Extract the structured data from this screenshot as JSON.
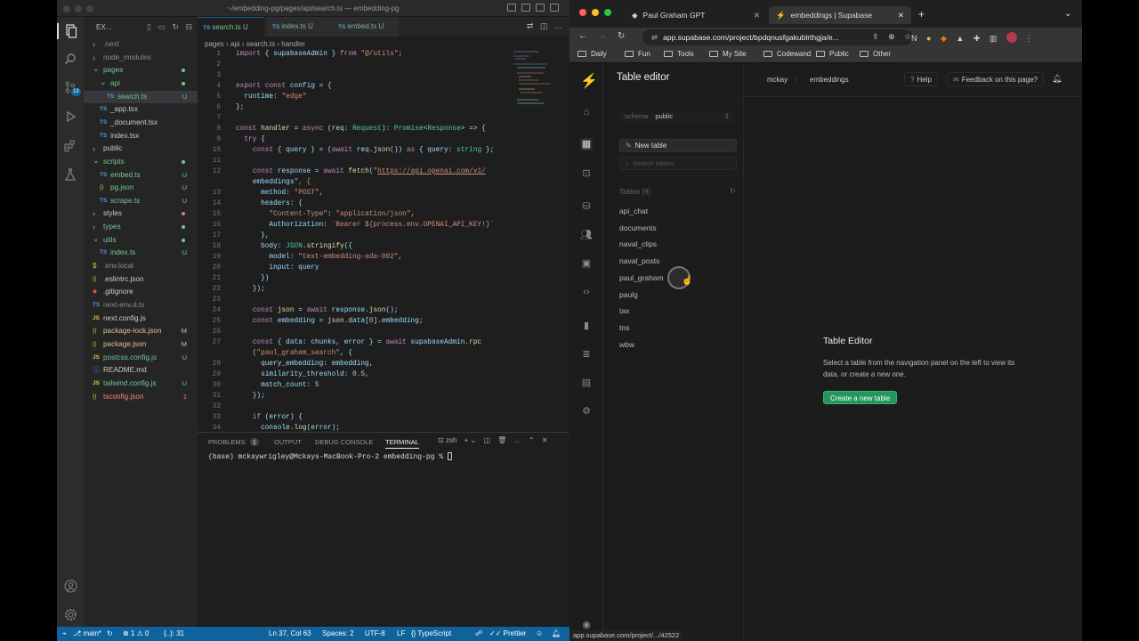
{
  "vscode": {
    "title": "~/embedding-pg/pages/api/search.ts — embedding-pg",
    "explorer_label": "EX...",
    "tree": [
      {
        "name": ".next",
        "depth": 0,
        "type": "folder",
        "color": "#8c8c8c"
      },
      {
        "name": "node_modules",
        "depth": 0,
        "type": "folder",
        "color": "#8c8c8c"
      },
      {
        "name": "pages",
        "depth": 0,
        "type": "folder-open",
        "color": "#73c991",
        "dot": "#73c991"
      },
      {
        "name": "api",
        "depth": 1,
        "type": "folder-open",
        "color": "#73c991",
        "dot": "#73c991"
      },
      {
        "name": "search.ts",
        "depth": 2,
        "type": "ts",
        "color": "#73c991",
        "status": "U",
        "selected": true
      },
      {
        "name": "_app.tsx",
        "depth": 1,
        "type": "ts",
        "color": "#cccccc"
      },
      {
        "name": "_document.tsx",
        "depth": 1,
        "type": "ts",
        "color": "#cccccc"
      },
      {
        "name": "index.tsx",
        "depth": 1,
        "type": "ts",
        "color": "#cccccc"
      },
      {
        "name": "public",
        "depth": 0,
        "type": "folder",
        "color": "#cccccc"
      },
      {
        "name": "scripts",
        "depth": 0,
        "type": "folder-open",
        "color": "#73c991",
        "dot": "#73c991"
      },
      {
        "name": "embed.ts",
        "depth": 1,
        "type": "ts",
        "color": "#73c991",
        "status": "U"
      },
      {
        "name": "pg.json",
        "depth": 1,
        "type": "json",
        "color": "#73c991",
        "status": "U"
      },
      {
        "name": "scrape.ts",
        "depth": 1,
        "type": "ts",
        "color": "#73c991",
        "status": "U"
      },
      {
        "name": "styles",
        "depth": 0,
        "type": "folder",
        "color": "#cccccc",
        "dot": "#e2766b"
      },
      {
        "name": "types",
        "depth": 0,
        "type": "folder",
        "color": "#73c991",
        "dot": "#73c991"
      },
      {
        "name": "utils",
        "depth": 0,
        "type": "folder-open",
        "color": "#73c991",
        "dot": "#73c991"
      },
      {
        "name": "index.ts",
        "depth": 1,
        "type": "ts",
        "color": "#73c991",
        "status": "U"
      },
      {
        "name": ".env.local",
        "depth": 0,
        "type": "env",
        "color": "#8c8c8c"
      },
      {
        "name": ".eslintrc.json",
        "depth": 0,
        "type": "json",
        "color": "#cccccc"
      },
      {
        "name": ".gitignore",
        "depth": 0,
        "type": "git",
        "color": "#cccccc"
      },
      {
        "name": "next-env.d.ts",
        "depth": 0,
        "type": "ts",
        "color": "#8c8c8c"
      },
      {
        "name": "next.config.js",
        "depth": 0,
        "type": "js",
        "color": "#cccccc"
      },
      {
        "name": "package-lock.json",
        "depth": 0,
        "type": "json",
        "color": "#e2c08d",
        "status": "M"
      },
      {
        "name": "package.json",
        "depth": 0,
        "type": "json",
        "color": "#e2c08d",
        "status": "M"
      },
      {
        "name": "postcss.config.js",
        "depth": 0,
        "type": "js",
        "color": "#73c991",
        "status": "U"
      },
      {
        "name": "README.md",
        "depth": 0,
        "type": "md",
        "color": "#cccccc"
      },
      {
        "name": "tailwind.config.js",
        "depth": 0,
        "type": "js",
        "color": "#73c991",
        "status": "U"
      },
      {
        "name": "tsconfig.json",
        "depth": 0,
        "type": "json",
        "color": "#f48771",
        "status": "1"
      }
    ],
    "tabs": [
      {
        "label": "search.ts",
        "status": "U",
        "active": true
      },
      {
        "label": "index.ts",
        "status": "U",
        "active": false
      },
      {
        "label": "embed.ts",
        "status": "U",
        "active": false
      }
    ],
    "breadcrumb": "pages › api › search.ts › handler",
    "code": [
      {
        "n": "1",
        "t": "import { supabaseAdmin } from \"@/utils\";"
      },
      {
        "n": "2",
        "t": ""
      },
      {
        "n": "3",
        "t": ""
      },
      {
        "n": "4",
        "t": "export const config = {"
      },
      {
        "n": "5",
        "t": "  runtime: \"edge\""
      },
      {
        "n": "6",
        "t": "};"
      },
      {
        "n": "7",
        "t": ""
      },
      {
        "n": "8",
        "t": "const handler = async (req: Request): Promise<Response> => {"
      },
      {
        "n": "9",
        "t": "  try {"
      },
      {
        "n": "10",
        "t": "    const { query } = (await req.json()) as { query: string };"
      },
      {
        "n": "11",
        "t": ""
      },
      {
        "n": "12",
        "t": "    const response = await fetch(\"https://api.openai.com/v1/"
      },
      {
        "n": "",
        "t": "    embeddings\", {"
      },
      {
        "n": "13",
        "t": "      method: \"POST\","
      },
      {
        "n": "14",
        "t": "      headers: {"
      },
      {
        "n": "15",
        "t": "        \"Content-Type\": \"application/json\","
      },
      {
        "n": "16",
        "t": "        Authorization: `Bearer ${process.env.OPENAI_API_KEY!}`"
      },
      {
        "n": "17",
        "t": "      },"
      },
      {
        "n": "18",
        "t": "      body: JSON.stringify({"
      },
      {
        "n": "19",
        "t": "        model: \"text-embedding-ada-002\","
      },
      {
        "n": "20",
        "t": "        input: query"
      },
      {
        "n": "21",
        "t": "      })"
      },
      {
        "n": "22",
        "t": "    });"
      },
      {
        "n": "23",
        "t": ""
      },
      {
        "n": "24",
        "t": "    const json = await response.json();"
      },
      {
        "n": "25",
        "t": "    const embedding = json.data[0].embedding;"
      },
      {
        "n": "26",
        "t": ""
      },
      {
        "n": "27",
        "t": "    const { data: chunks, error } = await supabaseAdmin.rpc"
      },
      {
        "n": "",
        "t": "    (\"paul_graham_search\", {"
      },
      {
        "n": "28",
        "t": "      query_embedding: embedding,"
      },
      {
        "n": "29",
        "t": "      similarity_threshold: 0.5,"
      },
      {
        "n": "30",
        "t": "      match_count: 5"
      },
      {
        "n": "31",
        "t": "    });"
      },
      {
        "n": "32",
        "t": ""
      },
      {
        "n": "33",
        "t": "    if (error) {"
      },
      {
        "n": "34",
        "t": "      console.log(error);"
      }
    ],
    "panel": {
      "problems": "PROBLEMS",
      "problems_count": "1",
      "output": "OUTPUT",
      "debug": "DEBUG CONSOLE",
      "terminal": "TERMINAL",
      "shell": "zsh",
      "prompt": "(base) mckaywrigley@Mckays-MacBook-Pro-2 embedding-pg % "
    },
    "status": {
      "branch": "main*",
      "problems": "⊗ 1 ⚠ 0",
      "braces": "{..}: 31",
      "position": "Ln 37, Col 63",
      "spaces": "Spaces: 2",
      "encoding": "UTF-8",
      "eol": "LF",
      "language": "TypeScript",
      "formatter": "Prettier"
    }
  },
  "browser": {
    "tabs": [
      {
        "label": "Paul Graham GPT",
        "active": false
      },
      {
        "label": "embeddings | Supabase",
        "active": true
      }
    ],
    "url": "app.supabase.com/project/bpdqnusfgakublrthgja/e...",
    "bookmarks": [
      "Daily",
      "Fun",
      "Tools",
      "My Site",
      "Codewand",
      "Public",
      "Other"
    ],
    "status_url": "app.supabase.com/project/.../42522"
  },
  "supabase": {
    "brand_color": "#3ecf8e",
    "header_title": "Table editor",
    "schema_label": "schema",
    "schema_value": "public",
    "new_table": "New table",
    "search_placeholder": "Search tables",
    "tables_header": "Tables (9)",
    "tables": [
      "api_chat",
      "documents",
      "naval_clips",
      "naval_posts",
      "paul_graham",
      "paulg",
      "tax",
      "tns",
      "wbw"
    ],
    "crumb_org": "mckay",
    "crumb_project": "embeddings",
    "help": "Help",
    "feedback": "Feedback on this page?",
    "empty_title": "Table Editor",
    "empty_body": "Select a table from the navigation panel on the left to view its data, or create a new one.",
    "create_button": "Create a new table"
  }
}
